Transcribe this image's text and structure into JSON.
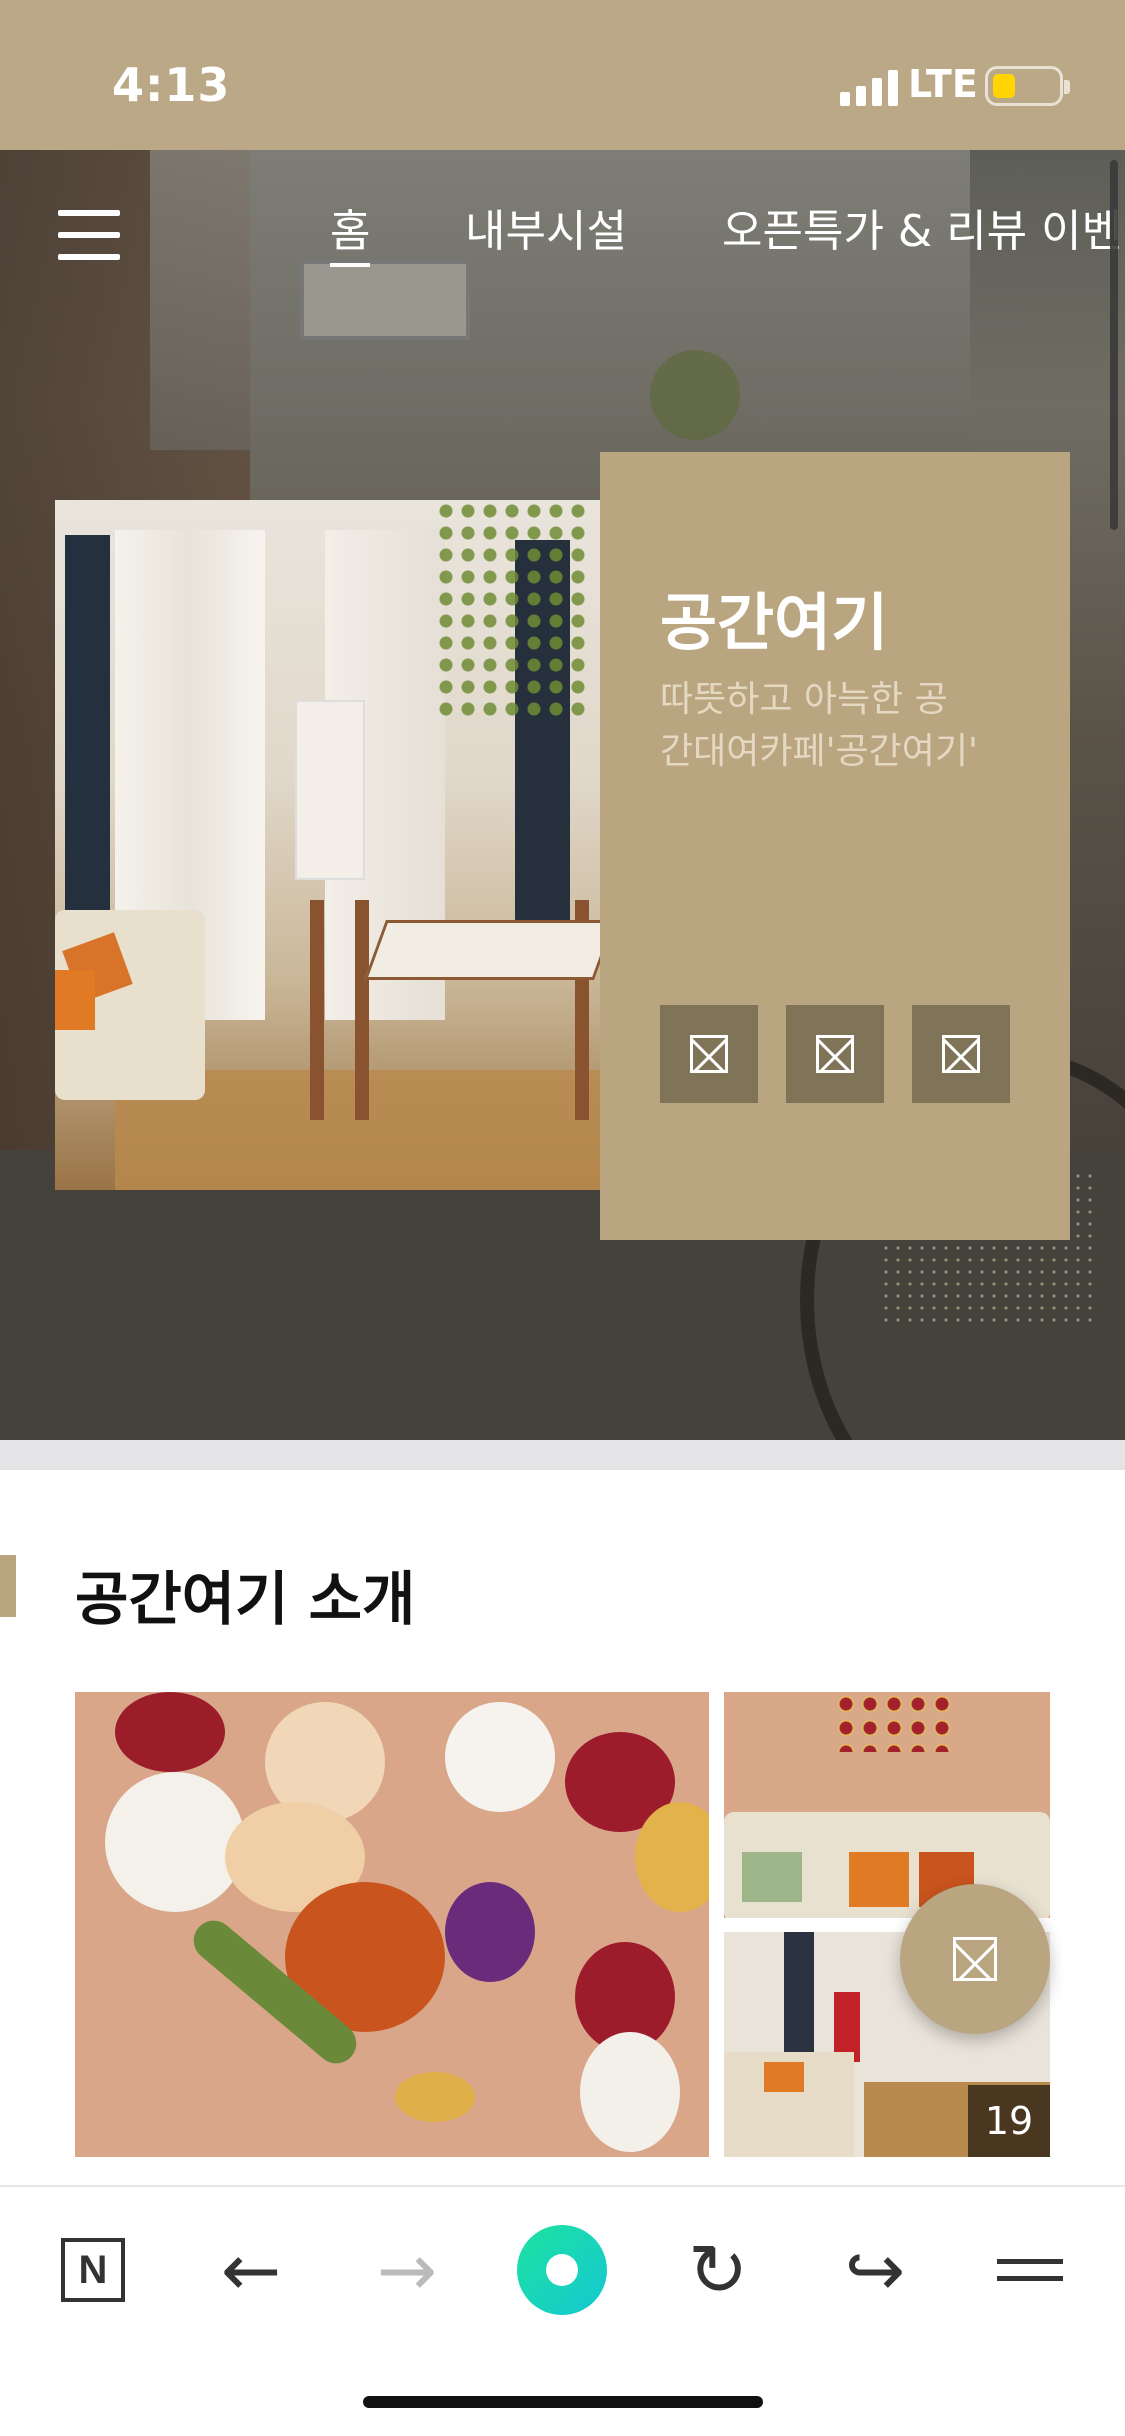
{
  "status_bar": {
    "time": "4:13",
    "network": "LTE"
  },
  "nav": {
    "tabs": [
      {
        "label": "홈",
        "active": true
      },
      {
        "label": "내부시설",
        "active": false
      },
      {
        "label": "오픈특가 & 리뷰 이벤",
        "active": false
      }
    ]
  },
  "hero_card": {
    "title": "공간여기",
    "description": "따뜻하고 아늑한 공간대여카페'공간여기'",
    "icons": [
      "broken-image-icon",
      "broken-image-icon",
      "broken-image-icon"
    ],
    "background_color": "#b9a680"
  },
  "section": {
    "title": "공간여기 소개"
  },
  "gallery": {
    "count": "19"
  },
  "toolbar": {
    "naver_label": "N",
    "back": "←",
    "forward": "→",
    "reload": "↻",
    "share": "↪"
  },
  "colors": {
    "accent": "#b9a680",
    "status_bar": "#bba886",
    "toolbar_green": "#1ee2a0"
  }
}
